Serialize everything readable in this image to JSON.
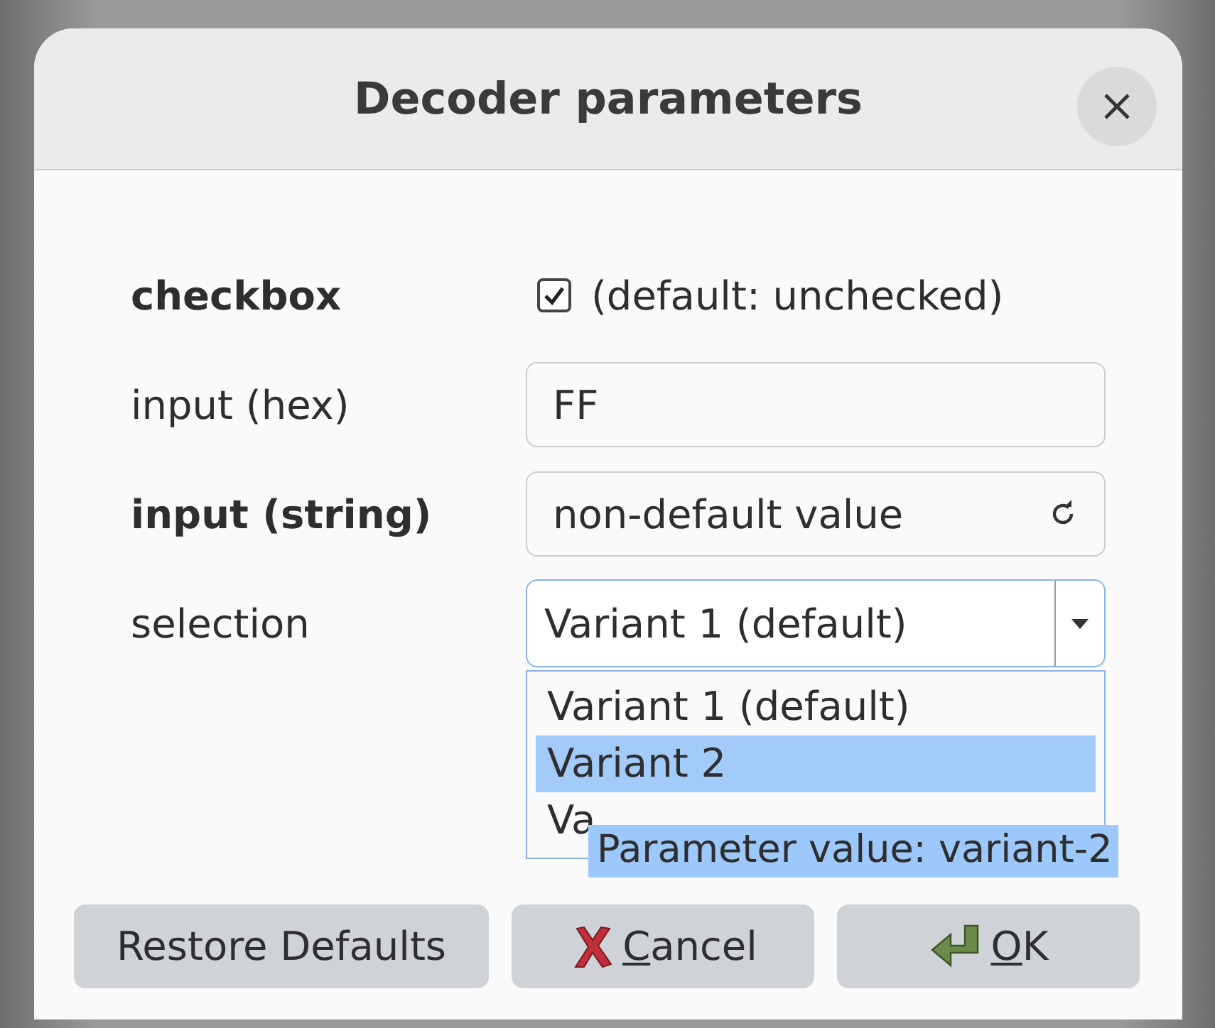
{
  "window": {
    "title": "Decoder parameters"
  },
  "parameters": [
    {
      "kind": "checkbox",
      "label": "checkbox",
      "modified": true,
      "checked": true,
      "note": "(default: unchecked)"
    },
    {
      "kind": "hex",
      "label": "input (hex)",
      "modified": false,
      "value": "FF"
    },
    {
      "kind": "string",
      "label": "input (string)",
      "modified": true,
      "value": "non-default value"
    },
    {
      "kind": "selection",
      "label": "selection",
      "modified": false,
      "value": "Variant 1 (default)",
      "expanded": true,
      "options": [
        {
          "label": "Variant 1 (default)",
          "highlighted": false
        },
        {
          "label": "Variant 2",
          "highlighted": true
        },
        {
          "label": "Va",
          "highlighted": false
        }
      ],
      "tooltip": "Parameter value: variant-2"
    }
  ],
  "buttons": [
    {
      "kind": "restore",
      "label": "Restore Defaults",
      "underline_first": false
    },
    {
      "kind": "cancel",
      "label": "Cancel",
      "underline_first": true
    },
    {
      "kind": "ok",
      "label": "OK",
      "underline_first": true
    }
  ]
}
